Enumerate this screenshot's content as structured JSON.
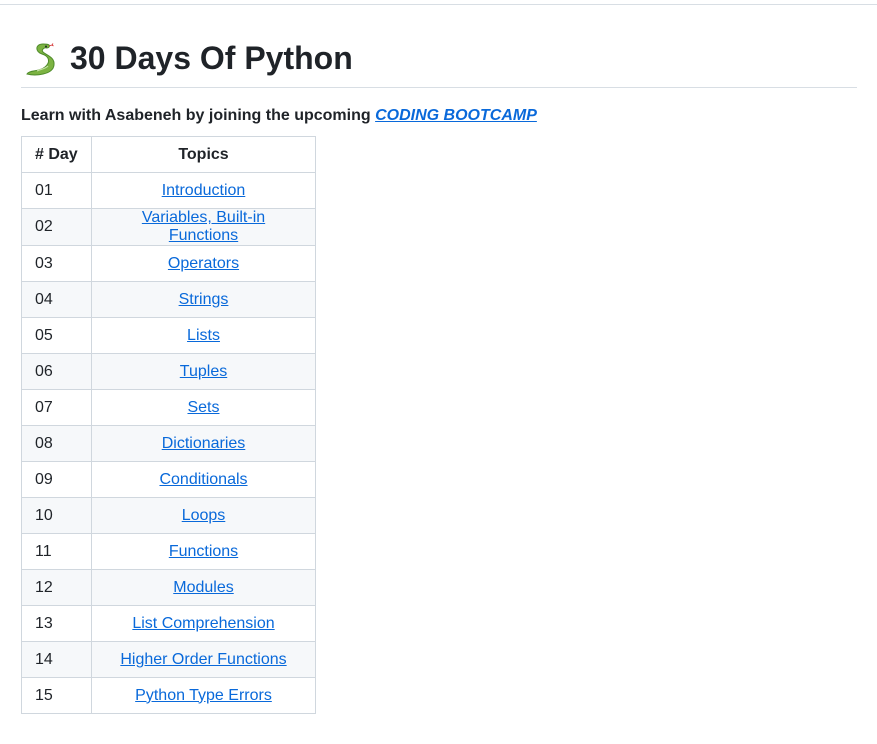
{
  "page": {
    "title": "30 Days Of Python",
    "subtitle_text": "Learn with Asabeneh by joining the upcoming ",
    "subtitle_link": "CODING BOOTCAMP"
  },
  "icons": {
    "title_icon": "snake-icon"
  },
  "colors": {
    "link": "#0969da",
    "border": "#d0d7de",
    "row_alt": "#f6f8fa"
  },
  "table": {
    "headers": [
      "# Day",
      "Topics"
    ],
    "rows": [
      {
        "day": "01",
        "topic": "Introduction"
      },
      {
        "day": "02",
        "topic": "Variables, Built-in Functions"
      },
      {
        "day": "03",
        "topic": "Operators"
      },
      {
        "day": "04",
        "topic": "Strings"
      },
      {
        "day": "05",
        "topic": "Lists"
      },
      {
        "day": "06",
        "topic": "Tuples"
      },
      {
        "day": "07",
        "topic": "Sets"
      },
      {
        "day": "08",
        "topic": "Dictionaries"
      },
      {
        "day": "09",
        "topic": "Conditionals"
      },
      {
        "day": "10",
        "topic": "Loops"
      },
      {
        "day": "11",
        "topic": "Functions"
      },
      {
        "day": "12",
        "topic": "Modules"
      },
      {
        "day": "13",
        "topic": "List Comprehension"
      },
      {
        "day": "14",
        "topic": "Higher Order Functions"
      },
      {
        "day": "15",
        "topic": "Python Type Errors"
      }
    ]
  }
}
